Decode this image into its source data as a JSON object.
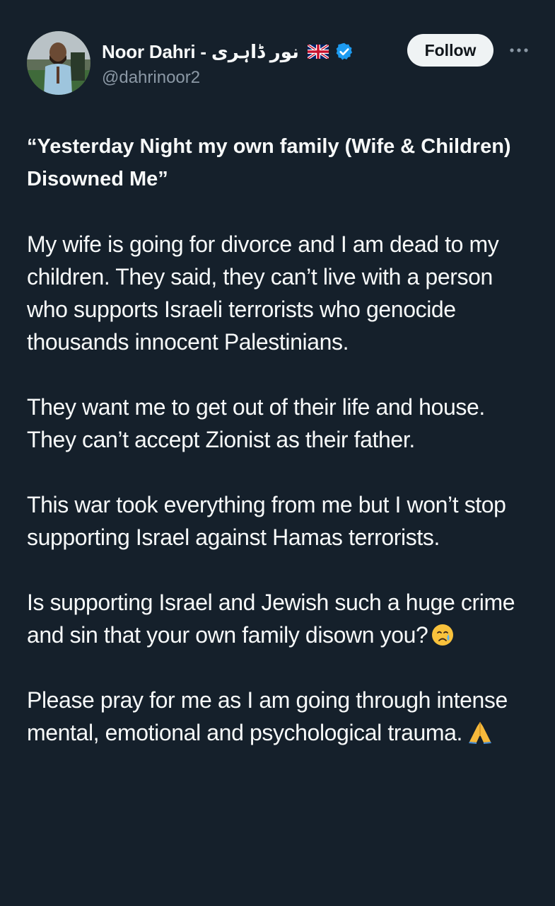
{
  "author": {
    "display_name": "Noor Dahri - نور ڈاہری",
    "handle": "@dahrinoor2",
    "flag_icon": "uk-flag-icon",
    "verified_icon": "verified-badge-icon",
    "verified_color": "#1d9bf0"
  },
  "actions": {
    "follow_label": "Follow",
    "more_icon": "more-horizontal-icon"
  },
  "post": {
    "headline": "“Yesterday Night my own family (Wife & Children) Disowned Me”",
    "paragraphs": [
      "My wife is going for divorce and I am dead to my children. They said, they can’t live with a person who supports Israeli terrorists who genocide thousands innocent Palestinians.",
      "They want me to get out of their life and house. They can’t accept Zionist as their father.",
      "This war took everything from me but I won’t stop supporting Israel against Hamas terrorists.",
      "Is supporting Israel and Jewish such a huge crime and sin that your own family disown you?",
      "Please pray for me as I am going through intense mental, emotional and psychological trauma."
    ],
    "emoji": {
      "crying": "crying-face-emoji",
      "praying": "folded-hands-emoji"
    }
  },
  "colors": {
    "background": "#15202b",
    "text_primary": "#f7f9f9",
    "text_secondary": "#8b98a5",
    "follow_bg": "#eff3f4"
  }
}
